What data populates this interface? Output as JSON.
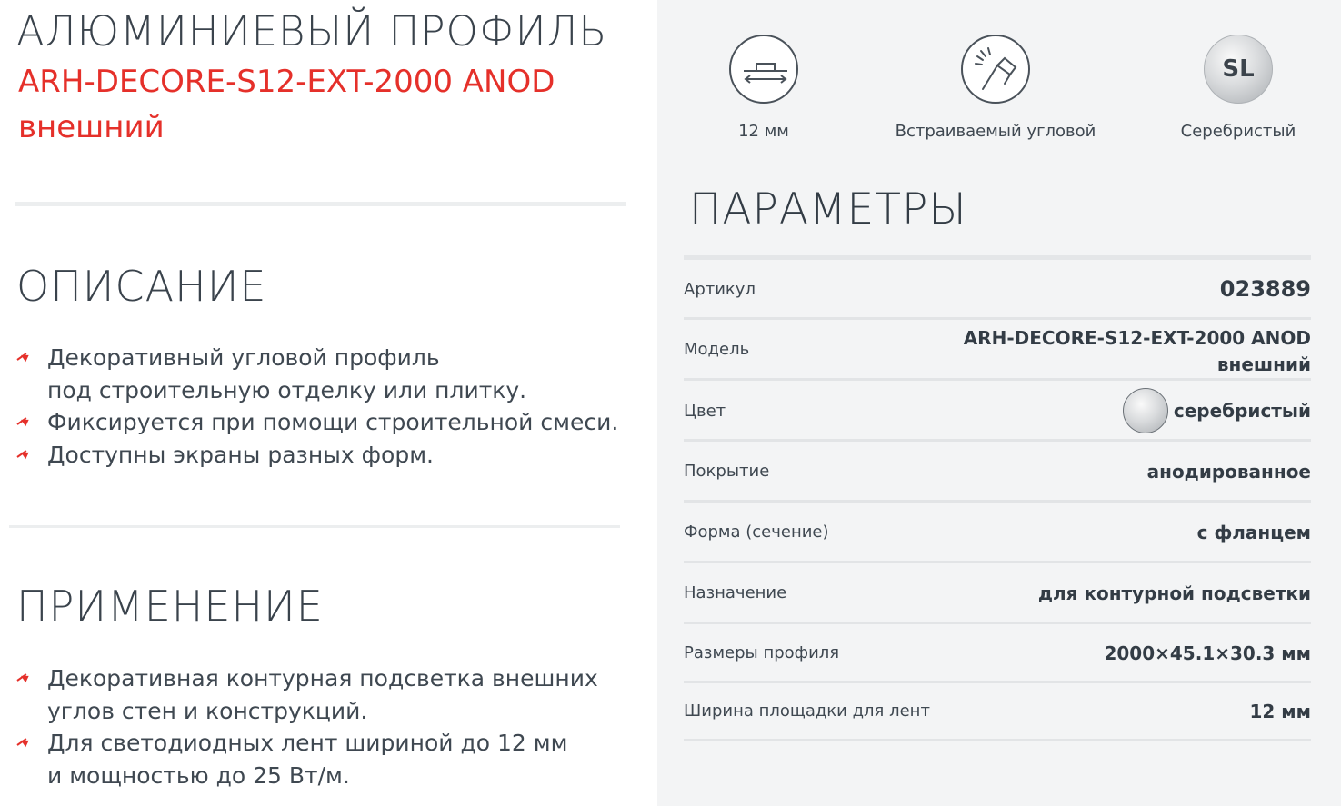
{
  "product": {
    "category": "АЛЮМИНИЕВЫЙ ПРОФИЛЬ",
    "model": "ARH-DECORE-S12-EXT-2000 ANOD",
    "variant": "внешний"
  },
  "description": {
    "heading": "ОПИСАНИЕ",
    "bullets": [
      [
        "Декоративный угловой профиль",
        "под строительную отделку или плитку."
      ],
      [
        "Фиксируется при помощи строительной смеси."
      ],
      [
        "Доступны экраны разных форм."
      ]
    ]
  },
  "application": {
    "heading": "ПРИМЕНЕНИЕ",
    "bullets": [
      [
        "Декоративная контурная подсветка внешних",
        "углов стен и конструкций."
      ],
      [
        "Для светодиодных лент шириной до 12 мм",
        "и мощностью до 25 Вт/м."
      ]
    ]
  },
  "features": [
    {
      "icon": "width-profile-icon",
      "label": "12 мм"
    },
    {
      "icon": "corner-mount-icon",
      "label": "Встраиваемый угловой"
    },
    {
      "icon": "silver-color-icon",
      "badge": "SL",
      "label": "Серебристый",
      "color": "#c8cacc"
    }
  ],
  "params": {
    "heading": "ПАРАМЕТРЫ",
    "rows": [
      {
        "key": "Артикул",
        "value": "023889"
      },
      {
        "key": "Модель",
        "value_lines": [
          "ARH-DECORE-S12-EXT-2000 ANOD",
          "внешний"
        ]
      },
      {
        "key": "Цвет",
        "value": "серебристый",
        "swatch": "#c8cacc"
      },
      {
        "key": "Покрытие",
        "value": "анодированное"
      },
      {
        "key": "Форма (сечение)",
        "value": "с фланцем"
      },
      {
        "key": "Назначение",
        "value": "для контурной подсветки"
      },
      {
        "key": "Размеры профиля",
        "value": "2000×45.1×30.3 мм"
      },
      {
        "key": "Ширина площадки для лент",
        "value": "12 мм"
      }
    ]
  },
  "colors": {
    "accent": "#e5302a",
    "text": "#333c45",
    "panel": "#f3f4f5"
  }
}
